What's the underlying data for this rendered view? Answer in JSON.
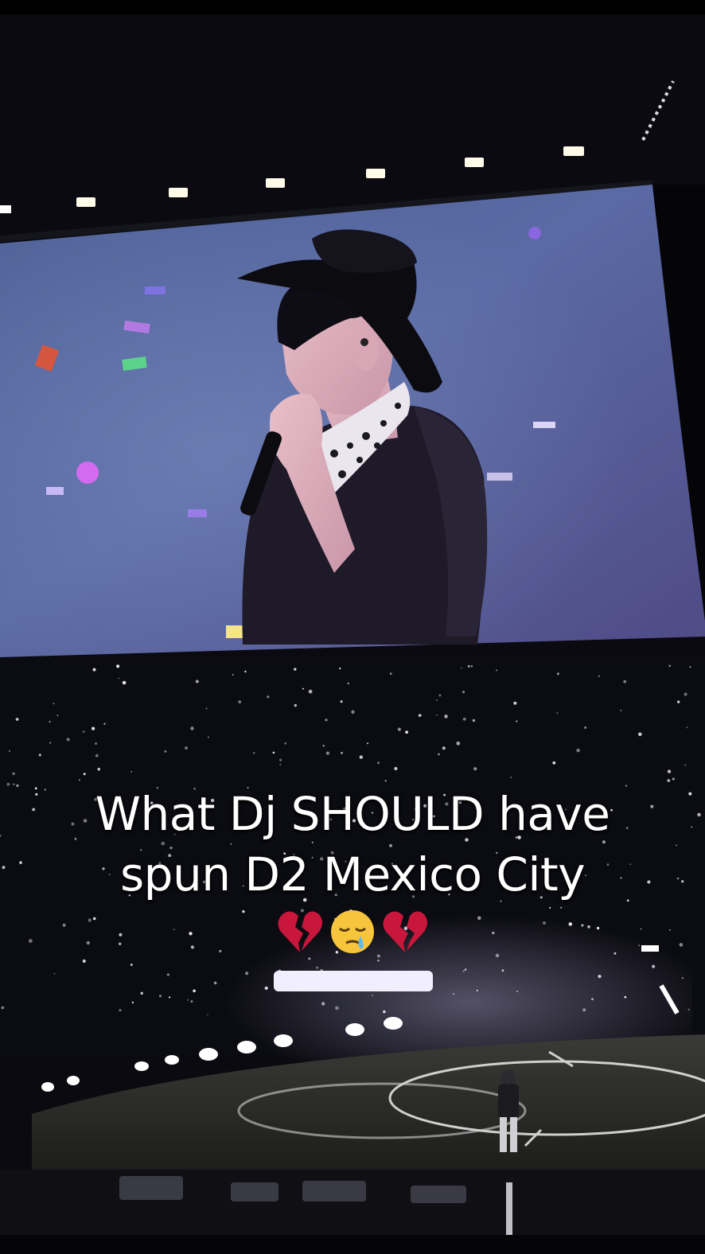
{
  "caption": {
    "line1": "What Dj SHOULD have",
    "line2": "spun D2 Mexico City"
  },
  "emojis": [
    "broken-heart-icon",
    "sleepy-face-icon",
    "broken-heart-icon"
  ],
  "colors": {
    "screen_blue": "#5a6da0",
    "screen_purple": "#5a4f8a",
    "caption_text": "#ffffff",
    "broken_heart": "#c9163b",
    "sleepy_face": "#f7c53b",
    "arena_dark": "#07070c"
  }
}
